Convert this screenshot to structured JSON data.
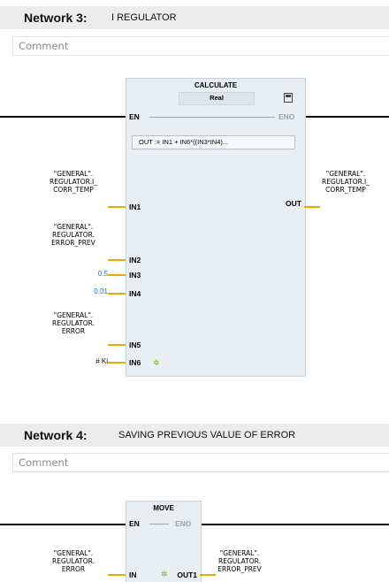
{
  "network3": {
    "number": "Network 3:",
    "title": "I REGULATOR",
    "comment": "Comment",
    "block": {
      "name": "CALCULATE",
      "type": "Real",
      "formula": "OUT :=   IN1 + IN6*((IN3*IN4)...",
      "en": "EN",
      "eno": "ENO",
      "out": "OUT",
      "in1": "IN1",
      "in2": "IN2",
      "in3": "IN3",
      "in4": "IN4",
      "in5": "IN5",
      "in6": "IN6"
    },
    "operands": {
      "in1": [
        "\"GENERAL\".",
        "REGULATOR.I_",
        "CORR_TEMP"
      ],
      "in2": [
        "\"GENERAL\".",
        "REGULATOR.",
        "ERROR_PREV"
      ],
      "in3": "0.5",
      "in4": "0.01",
      "in5": [
        "\"GENERAL\".",
        "REGULATOR.",
        "ERROR"
      ],
      "in6": "# Ki",
      "out": [
        "\"GENERAL\".",
        "REGULATOR.I_",
        "CORR_TEMP"
      ]
    }
  },
  "network4": {
    "number": "Network 4:",
    "title": "SAVING PREVIOUS VALUE OF ERROR",
    "comment": "Comment",
    "block": {
      "name": "MOVE",
      "en": "EN",
      "eno": "ENO",
      "in": "IN",
      "out1": "OUT1"
    },
    "operands": {
      "in": [
        "\"GENERAL\".",
        "REGULATOR.",
        "ERROR"
      ],
      "out1": [
        "\"GENERAL\".",
        "REGULATOR.",
        "ERROR_PREV"
      ]
    }
  },
  "colors": {
    "header_bg": "#ececec",
    "block_bg": "#e9eef3",
    "pin_stub": "#f0a500",
    "constant_value": "#1a6fc4",
    "enable_out_disabled": "#9aa3ab"
  },
  "icons": [
    "calculator-edit-icon",
    "invert-star-icon"
  ]
}
